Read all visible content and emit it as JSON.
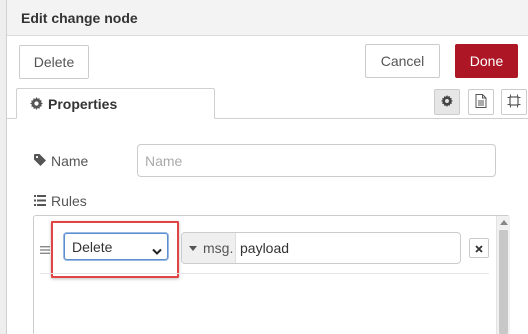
{
  "dialog": {
    "title": "Edit change node"
  },
  "toolbar": {
    "delete_label": "Delete",
    "cancel_label": "Cancel",
    "done_label": "Done"
  },
  "tabs": [
    {
      "label": "Properties",
      "icon": "gear-icon",
      "active": true
    }
  ],
  "tab_buttons": [
    {
      "icon": "gear-icon",
      "active": true
    },
    {
      "icon": "document-icon",
      "active": false
    },
    {
      "icon": "frame-icon",
      "active": false
    }
  ],
  "form": {
    "name": {
      "label": "Name",
      "value": "",
      "placeholder": "Name",
      "icon": "tag-icon"
    },
    "rules": {
      "label": "Rules",
      "icon": "list-icon"
    }
  },
  "rules": [
    {
      "operation": "Delete",
      "property_type": "msg.",
      "property": "payload"
    }
  ],
  "colors": {
    "done_button": "#ad1625",
    "highlight": "#e04444",
    "focus_border": "#5b8fd0"
  }
}
